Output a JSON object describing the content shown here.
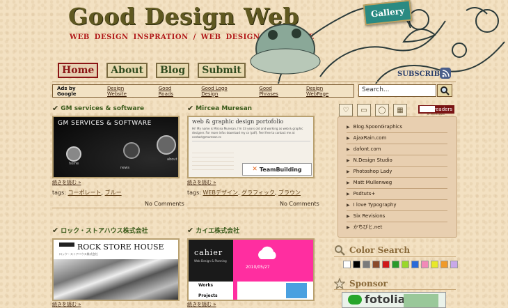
{
  "site": {
    "title": "Good Design Web",
    "tagline": "WEB DESIGN INSPRATION / WEB DESIGN SHOWCASE",
    "gallery_label": "Gallery"
  },
  "nav": {
    "items": [
      {
        "label": "Home",
        "active": true
      },
      {
        "label": "About",
        "active": false
      },
      {
        "label": "Blog",
        "active": false
      },
      {
        "label": "Submit",
        "active": false
      }
    ]
  },
  "subscribe": {
    "label": "SUBSCRIBE",
    "icon": "rss-icon"
  },
  "ads": {
    "label": "Ads by Google",
    "links": [
      "Design Website",
      "Good Roads",
      "Good Logo Design",
      "Good Phrases",
      "Design WebPage"
    ]
  },
  "search": {
    "placeholder": "Search...",
    "icon": "magnifier-icon"
  },
  "posts": [
    {
      "title": "GM services & software",
      "thumb_heading": "GM SERVICES & SOFTWARE",
      "thumb_labels": [
        "home",
        "news",
        "about"
      ],
      "more": "続きを読む »",
      "tags_label": "tags:",
      "tags": [
        "コーポレート",
        "ブルー"
      ],
      "comments": "No Comments"
    },
    {
      "title": "Mircea Muresan",
      "thumb_heading": "web & graphic design portofolio",
      "thumb_text": "Hi! My name is Mircea Muresan. I'm 33 years old and working as web & graphic designer. For more infos download my cv (pdf). Feel free to contact me at contact@muresan.ro",
      "thumb_badge": "TeamBuilding",
      "more": "続きを読む »",
      "tags_label": "tags:",
      "tags": [
        "WEBデザイン",
        "グラフィック",
        "ブラウン"
      ],
      "comments": "No Comments"
    },
    {
      "title": "ロック・ストアハウス株式会社",
      "thumb_heading": "ROCK STORE HOUSE",
      "thumb_sub": "ロック・ストアハウス株式会社",
      "more": "続きを読む »"
    },
    {
      "title": "カイエ株式会社",
      "thumb_heading": "cahier",
      "thumb_sub": "Web Design & Planning",
      "thumb_date": "2010/05/27",
      "thumb_works": "Works",
      "thumb_projects": "Projects",
      "more": "続きを読む »"
    }
  ],
  "sidebar": {
    "tab_icons": [
      "heart-icon",
      "folder-icon",
      "comment-icon",
      "calendar-icon"
    ],
    "readers_label": "readers",
    "readers_sub": "BY FEEDBURNER",
    "blogs": [
      "Blog.SpoonGraphics",
      "AjaxRain.com",
      "dafont.com",
      "N.Design Studio",
      "Photoshop Lady",
      "Matt Mullenweg",
      "Psdtuts+",
      "I love Typography",
      "Six Revisions",
      "かちびと.net"
    ],
    "color_search_title": "Color Search",
    "colors": [
      "#ffffff",
      "#000000",
      "#7a7a7a",
      "#8a4a2a",
      "#d01818",
      "#2a9a2a",
      "#9ad82a",
      "#2a6ad8",
      "#f28ab8",
      "#e8e82a",
      "#f09a2a",
      "#c8a8e8"
    ],
    "sponsor_title": "Sponsor",
    "sponsor_name": "fotolia"
  }
}
